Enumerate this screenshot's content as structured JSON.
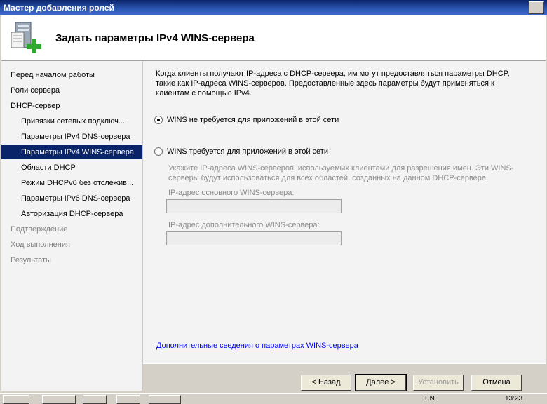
{
  "window": {
    "title": "Мастер добавления ролей"
  },
  "header": {
    "title": "Задать параметры IPv4 WINS-сервера",
    "icon": "server-role-add-icon"
  },
  "nav": {
    "items": [
      {
        "label": "Перед началом работы",
        "level": 0,
        "state": "normal"
      },
      {
        "label": "Роли сервера",
        "level": 0,
        "state": "normal"
      },
      {
        "label": "DHCP-сервер",
        "level": 0,
        "state": "normal"
      },
      {
        "label": "Привязки сетевых подключ...",
        "level": 1,
        "state": "normal"
      },
      {
        "label": "Параметры IPv4 DNS-сервера",
        "level": 1,
        "state": "normal"
      },
      {
        "label": "Параметры IPv4 WINS-сервера",
        "level": 1,
        "state": "selected"
      },
      {
        "label": "Области DHCP",
        "level": 1,
        "state": "normal"
      },
      {
        "label": "Режим DHCPv6 без отслежив...",
        "level": 1,
        "state": "normal"
      },
      {
        "label": "Параметры IPv6 DNS-сервера",
        "level": 1,
        "state": "normal"
      },
      {
        "label": "Авторизация DHCP-сервера",
        "level": 1,
        "state": "normal"
      },
      {
        "label": "Подтверждение",
        "level": 0,
        "state": "disabled"
      },
      {
        "label": "Ход выполнения",
        "level": 0,
        "state": "disabled"
      },
      {
        "label": "Результаты",
        "level": 0,
        "state": "disabled"
      }
    ]
  },
  "content": {
    "intro": "Когда клиенты получают IP-адреса с DHCP-сервера, им могут предоставляться параметры DHCP, такие как IP-адреса WINS-серверов. Предоставленные здесь параметры будут применяться к клиентам с помощью IPv4.",
    "option_not_required": "WINS не требуется для приложений в этой сети",
    "option_required": "WINS требуется для приложений в этой сети",
    "selected_option": "not_required",
    "hint": "Укажите IP-адреса WINS-серверов, используемых клиентами для разрешения имен. Эти WINS-серверы будут использоваться для всех областей, созданных на данном DHCP-сервере.",
    "primary_label": "IP-адрес основного WINS-сервера:",
    "primary_value": "",
    "secondary_label": "IP-адрес дополнительного WINS-сервера:",
    "secondary_value": "",
    "more_info_link": "Дополнительные сведения о параметрах WINS-сервера"
  },
  "buttons": {
    "back": "< Назад",
    "next": "Далее >",
    "install": "Установить",
    "cancel": "Отмена"
  },
  "taskbar": {
    "lang": "EN",
    "clock": "13:23"
  }
}
